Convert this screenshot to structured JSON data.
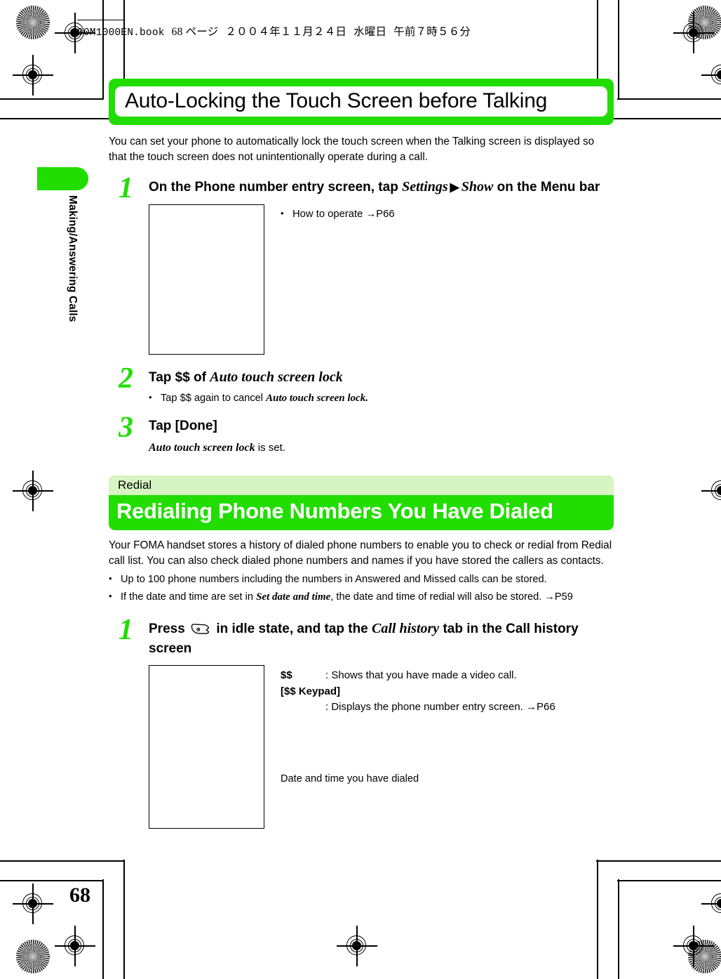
{
  "imprint": {
    "filename": "00M1000EN.book",
    "page_label": "68 ページ",
    "date": "２００４年１１月２４日",
    "weekday": "水曜日",
    "time": "午前７時５６分"
  },
  "side_tab": {
    "label": "Making/Answering Calls",
    "color": "#22dd00"
  },
  "section1": {
    "title": "Auto-Locking the Touch Screen before Talking",
    "banner_color": "#22dd00",
    "intro": "You can set your phone to automatically lock the touch screen when the Talking screen is displayed so that the touch screen does not unintentionally operate during a call.",
    "steps": [
      {
        "number": "1",
        "title_part1": "On the Phone number entry screen, tap ",
        "title_italic1": "Settings",
        "arrow": "▶",
        "title_italic2": "Show",
        "title_part2": " on the Menu bar",
        "note_bullet_dot": "•",
        "note_bullet_text": "How to operate →P66"
      },
      {
        "number": "2",
        "title_part1": "Tap $$ of ",
        "title_italic1": "Auto touch screen lock",
        "bullet_dot": "•",
        "bullet_pre": "Tap $$ again to cancel ",
        "bullet_italic": "Auto touch screen lock."
      },
      {
        "number": "3",
        "title_part1": "Tap [Done]",
        "note_italic": "Auto touch screen lock",
        "note_rest": " is set."
      }
    ]
  },
  "section2": {
    "subtitle": "Redial",
    "subtitle_bg": "#d6f5c2",
    "title": "Redialing Phone Numbers You Have Dialed",
    "banner_color": "#22dd00",
    "title_color": "#ffffff",
    "paragraph": "Your FOMA handset stores a history of dialed phone numbers to enable you to check or redial from Redial call list. You can also check dialed phone numbers and names if you have stored the callers as contacts.",
    "bullets": [
      {
        "dot": "•",
        "text": "Up to 100 phone numbers including the numbers in Answered and Missed calls can be stored."
      },
      {
        "dot": "•",
        "pre": "If the date and time are set in ",
        "italic": "Set date and time",
        "post": ", the date and time of redial will also be stored. →P59"
      }
    ],
    "step": {
      "number": "1",
      "title_pre": "Press ",
      "key_icon": "call-key-icon",
      "title_mid": " in idle state, and tap the ",
      "title_italic": "Call history",
      "title_post": " tab in the Call history screen"
    },
    "legend": [
      {
        "key": "$$",
        "sep": ":",
        "value": "Shows that you have made a video call."
      }
    ],
    "legend_strong": "[$$ Keypad]",
    "legend_indent_sep": ":",
    "legend_indent_value": "Displays the phone number entry screen. →P66",
    "caption": "Date and time you have dialed"
  },
  "page_number": "68"
}
